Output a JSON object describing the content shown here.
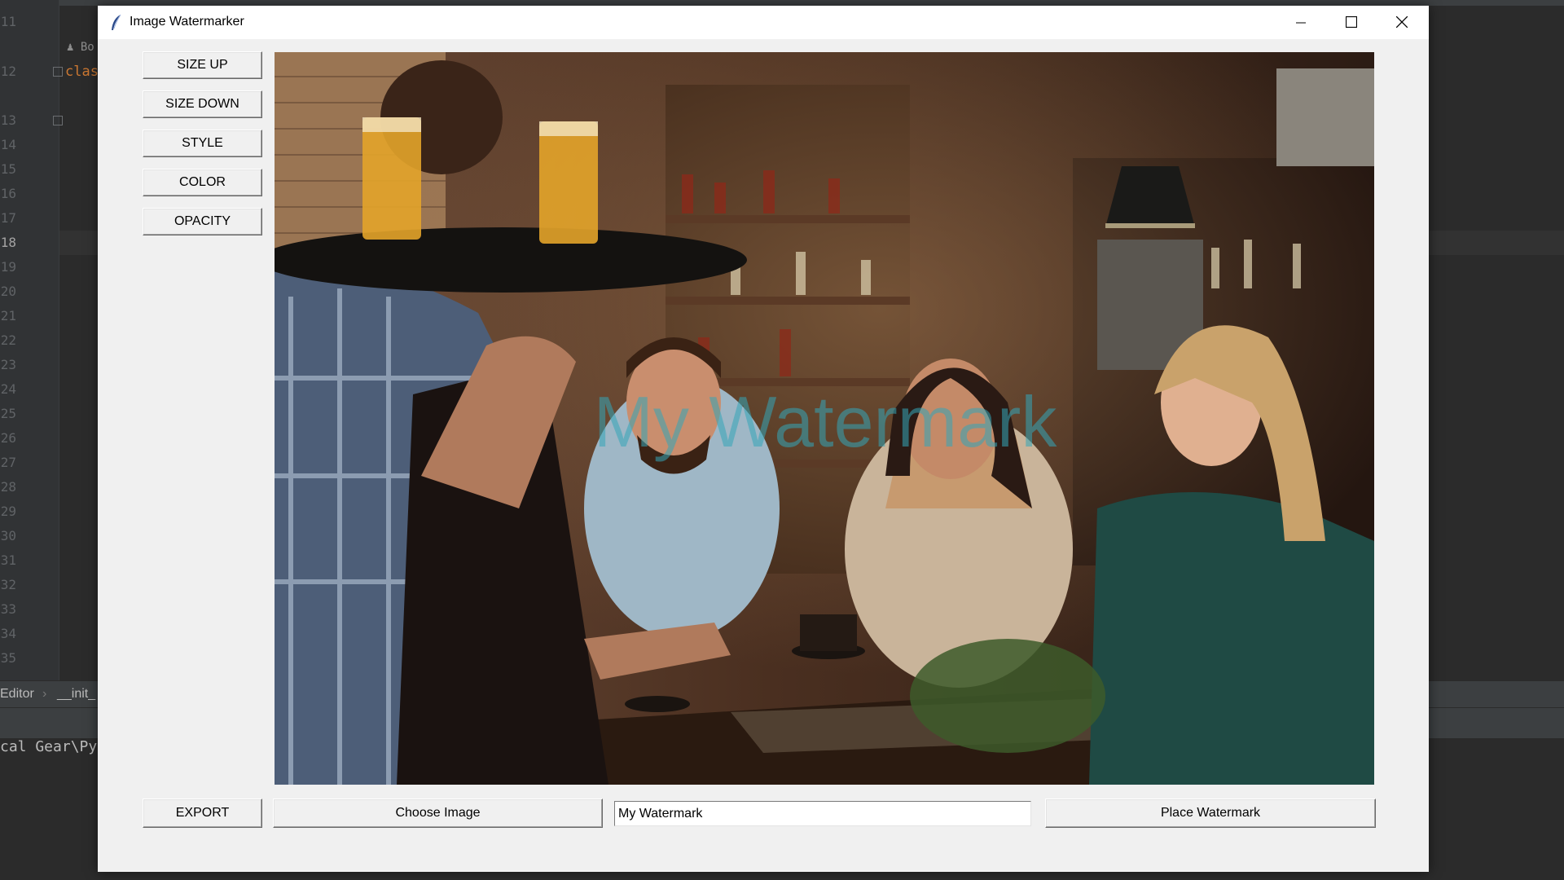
{
  "window": {
    "title": "Image Watermarker",
    "controls": {
      "minimize": "minimize-icon",
      "maximize": "maximize-icon",
      "close": "close-icon"
    }
  },
  "side_buttons": {
    "size_up": "SIZE UP",
    "size_down": "SIZE DOWN",
    "style": "STYLE",
    "color": "COLOR",
    "opacity": "OPACITY"
  },
  "canvas": {
    "watermark_text": "My Watermark",
    "watermark_color": "#34a6b8",
    "image_subject": "people laughing at a bar while a waiter serves drinks"
  },
  "bottom": {
    "export_label": "EXPORT",
    "choose_image_label": "Choose Image",
    "watermark_input_value": "My Watermark",
    "place_watermark_label": "Place Watermark"
  },
  "ide_background": {
    "line_numbers": [
      "11",
      "12",
      "13",
      "14",
      "15",
      "16",
      "17",
      "18",
      "19",
      "20",
      "21",
      "22",
      "23",
      "24",
      "25",
      "26",
      "27",
      "28",
      "29",
      "30",
      "31",
      "32",
      "33",
      "34",
      "35"
    ],
    "current_line": "18",
    "author_hint": "Bo",
    "code_fragment": "clas",
    "breadcrumb_1": "Editor",
    "breadcrumb_2": "__init_",
    "terminal_text": "cal Gear\\Pyc"
  },
  "colors": {
    "window_bg": "#f0f0f0",
    "titlebar_bg": "#ffffff",
    "ide_bg": "#2b2b2b",
    "keyword_orange": "#cc7832"
  }
}
